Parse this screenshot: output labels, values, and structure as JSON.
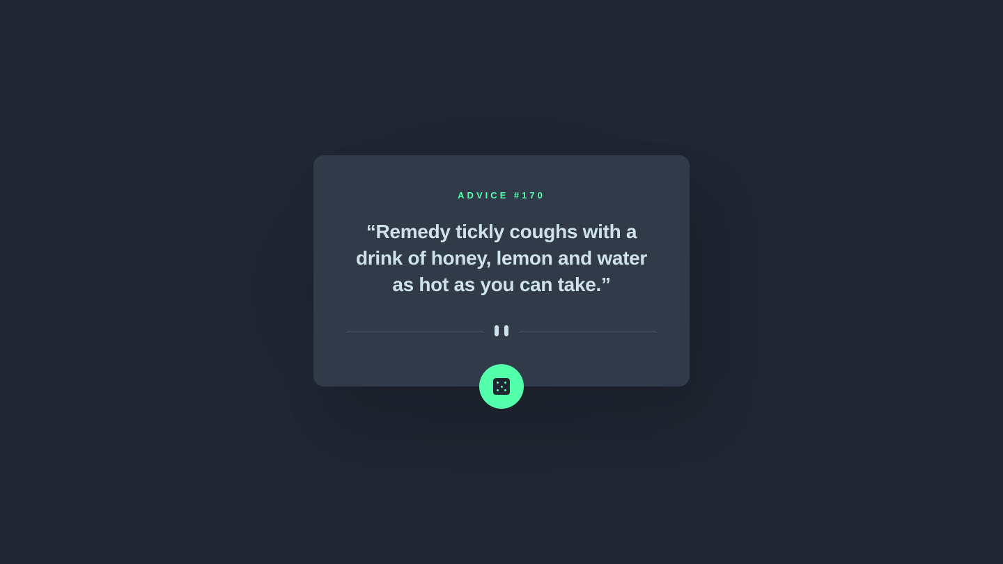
{
  "advice": {
    "id_label": "ADVICE #170",
    "quote": "“Remedy tickly coughs with a drink of honey, lemon and water as hot as you can take.”"
  },
  "divider": {
    "icon": "pause-icon"
  },
  "button": {
    "icon": "dice-icon"
  },
  "colors": {
    "background": "#202632",
    "card": "#313a48",
    "accent": "#53ffaa",
    "text": "#cee3e9",
    "divider_line": "#4f5d74"
  }
}
